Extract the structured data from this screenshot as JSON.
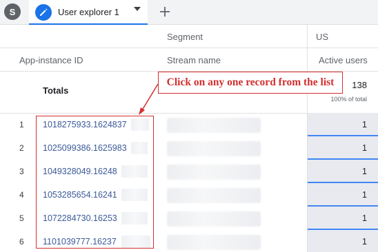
{
  "tabbar": {
    "segment_letter": "S",
    "tab_label": "User explorer 1",
    "add_symbol": "+"
  },
  "headers": {
    "segment_label": "Segment",
    "segment_value": "US",
    "col_id": "App-instance ID",
    "col_stream": "Stream name",
    "col_active": "Active users"
  },
  "totals": {
    "label": "Totals",
    "value": "138",
    "percent": "100% of total"
  },
  "rows": [
    {
      "num": "1",
      "id": "1018275933.1624837",
      "value": "1"
    },
    {
      "num": "2",
      "id": "1025099386.1625983",
      "value": "1"
    },
    {
      "num": "3",
      "id": "1049328049.16248",
      "value": "1"
    },
    {
      "num": "4",
      "id": "1053285654.16241",
      "value": "1"
    },
    {
      "num": "5",
      "id": "1072284730.16253",
      "value": "1"
    },
    {
      "num": "6",
      "id": "1101039777.16237",
      "value": "1"
    }
  ],
  "annotation": {
    "text": "Click on any one record from the list",
    "color": "#d32f2f"
  },
  "colors": {
    "accent": "#1a73e8",
    "link": "#3b5998",
    "active_cell": "#e8eaf0"
  },
  "icons": {
    "tab_icon": "pencil-icon",
    "dropdown": "caret-down-icon",
    "add": "plus-icon"
  }
}
